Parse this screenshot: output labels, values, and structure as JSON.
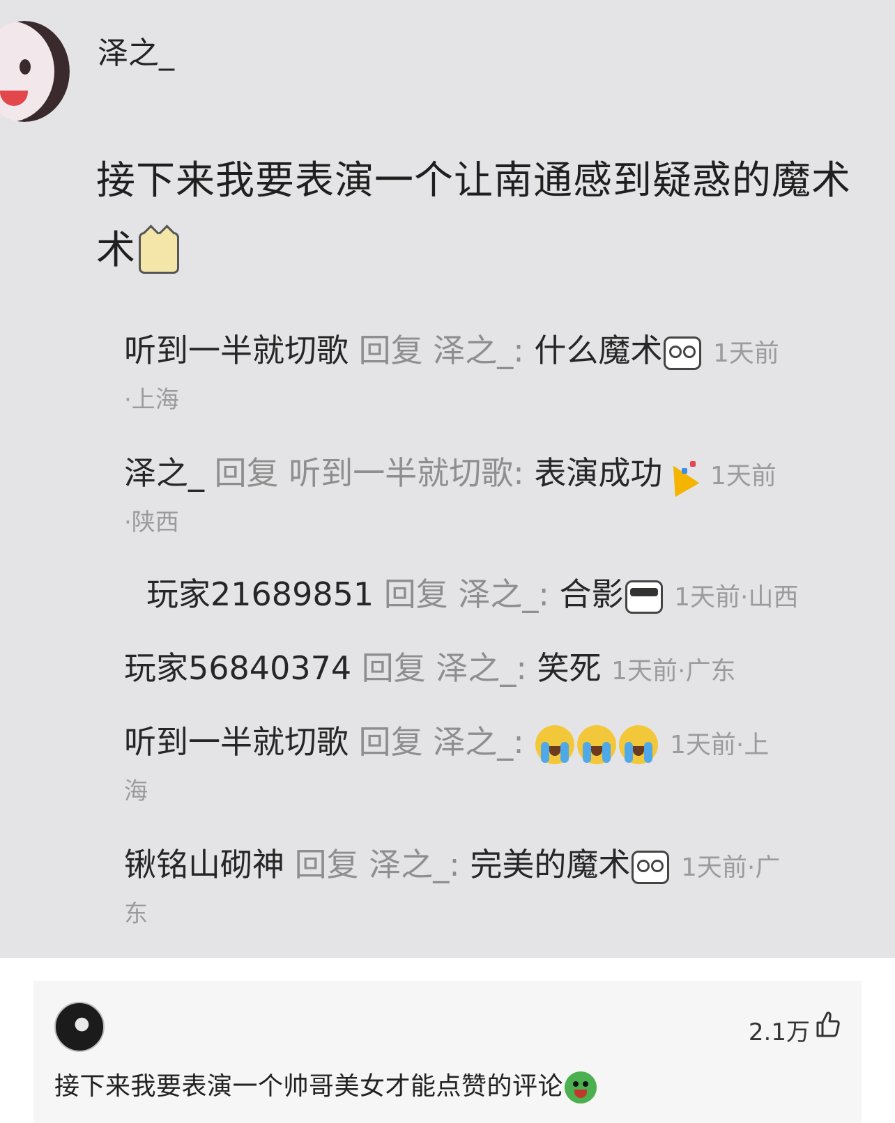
{
  "post": {
    "author": "泽之_",
    "text": "接下来我要表演一个让南通感到疑惑的魔术",
    "emoji": "cat-emoji"
  },
  "replies": [
    {
      "user": "听到一半就切歌",
      "reply_word": "回复",
      "target": "泽之_:",
      "text": "什么魔术",
      "emoji": "glasses-emoji",
      "time": "1天前",
      "location": "·上海"
    },
    {
      "user": "泽之_",
      "reply_word": "回复",
      "target": "听到一半就切歌:",
      "text": "表演成功",
      "emoji": "party-emoji",
      "time": "1天前",
      "location": "·陕西"
    },
    {
      "user": "玩家21689851",
      "reply_word": "回复",
      "target": "泽之_:",
      "text": "合影",
      "emoji": "sunglasses-emoji",
      "time": "1天前·山西"
    },
    {
      "user": "玩家56840374",
      "reply_word": "回复",
      "target": "泽之_:",
      "text": "笑死",
      "time": "1天前·广东"
    },
    {
      "user": "听到一半就切歌",
      "reply_word": "回复",
      "target": "泽之_:",
      "emoji": "crying-emoji",
      "time": "1天前·上",
      "location": "海"
    },
    {
      "user": "锹铭山砌神",
      "reply_word": "回复",
      "target": "泽之_:",
      "text": "完美的魔术",
      "emoji": "laugh-cry-emoji",
      "time": "1天前·广",
      "location": "东"
    }
  ],
  "comment": {
    "likes": "2.1万",
    "text": "接下来我要表演一个帅哥美女才能点赞的评论"
  }
}
